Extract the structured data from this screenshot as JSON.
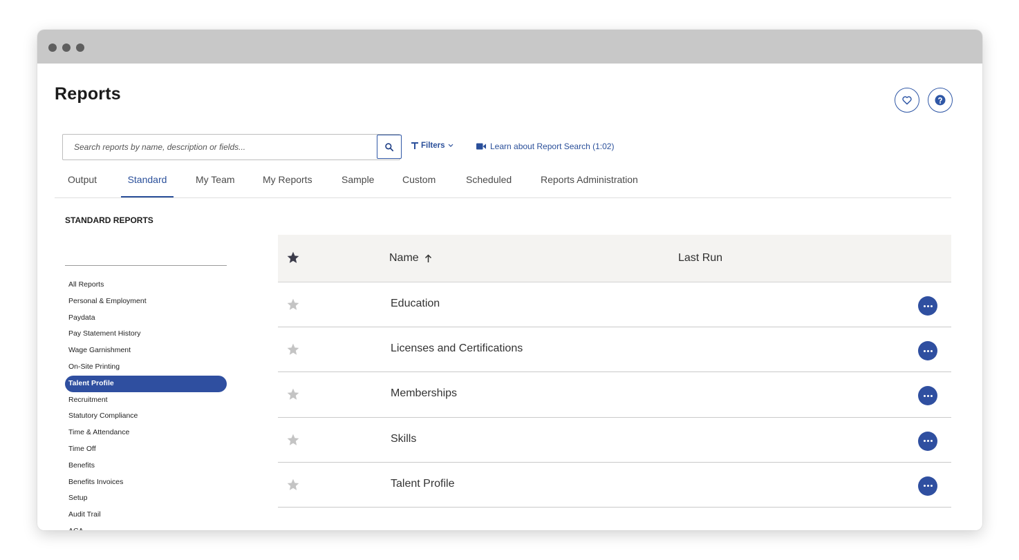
{
  "window": {
    "control_dots": [
      "window-close",
      "window-minimize",
      "window-maximize"
    ]
  },
  "header": {
    "title": "Reports",
    "favorite_icon": "heart-icon",
    "help_icon": "question-icon"
  },
  "search": {
    "placeholder": "Search reports by name, description or fields...",
    "value": "",
    "icon": "search-icon"
  },
  "filters": {
    "label": "Filters",
    "icon": "filter-icon",
    "chevron": "chevron-down-icon"
  },
  "learn_link": {
    "label": "Learn about Report Search (1:02)",
    "icon": "video-camera-icon"
  },
  "tabs": [
    {
      "label": "Output",
      "active": false
    },
    {
      "label": "Standard",
      "active": true
    },
    {
      "label": "My Team",
      "active": false
    },
    {
      "label": "My Reports",
      "active": false
    },
    {
      "label": "Sample",
      "active": false
    },
    {
      "label": "Custom",
      "active": false
    },
    {
      "label": "Scheduled",
      "active": false
    },
    {
      "label": "Reports Administration",
      "active": false
    }
  ],
  "sidebar": {
    "heading": "STANDARD REPORTS",
    "items": [
      {
        "label": "All Reports",
        "active": false
      },
      {
        "label": "Personal & Employment",
        "active": false
      },
      {
        "label": "Paydata",
        "active": false
      },
      {
        "label": "Pay Statement History",
        "active": false
      },
      {
        "label": "Wage Garnishment",
        "active": false
      },
      {
        "label": "On-Site Printing",
        "active": false
      },
      {
        "label": "Talent Profile",
        "active": true
      },
      {
        "label": "Recruitment",
        "active": false
      },
      {
        "label": "Statutory Compliance",
        "active": false
      },
      {
        "label": "Time & Attendance",
        "active": false
      },
      {
        "label": "Time Off",
        "active": false
      },
      {
        "label": "Benefits",
        "active": false
      },
      {
        "label": "Benefits Invoices",
        "active": false
      },
      {
        "label": "Setup",
        "active": false
      },
      {
        "label": "Audit Trail",
        "active": false
      },
      {
        "label": "ACA",
        "active": false
      }
    ]
  },
  "table": {
    "columns": {
      "favorite_icon": "star-icon",
      "name": "Name",
      "sort_icon": "arrow-up-icon",
      "last_run": "Last Run"
    },
    "rows": [
      {
        "name": "Education",
        "last_run": "",
        "favorite": false
      },
      {
        "name": "Licenses and Certifications",
        "last_run": "",
        "favorite": false
      },
      {
        "name": "Memberships",
        "last_run": "",
        "favorite": false
      },
      {
        "name": "Skills",
        "last_run": "",
        "favorite": false
      },
      {
        "name": "Talent Profile",
        "last_run": "",
        "favorite": false
      }
    ],
    "row_action_icon": "more-options-icon"
  },
  "colors": {
    "accent": "#2f4fa0",
    "link": "#2a4f9a",
    "titlebar": "#c8c8c8",
    "header_row": "#f4f3f1",
    "star_inactive": "#c4c4c4",
    "star_header": "#3b3b4a"
  }
}
